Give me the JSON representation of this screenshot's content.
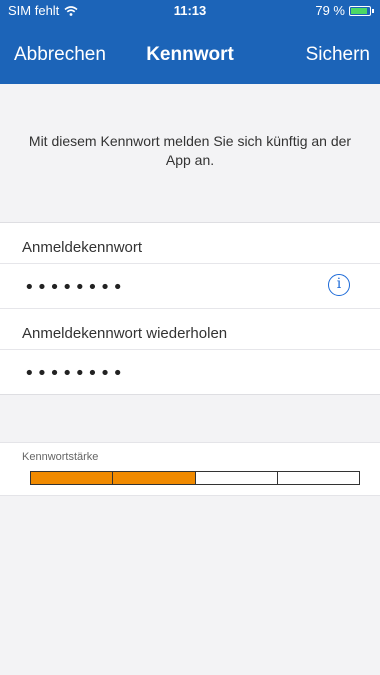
{
  "status": {
    "carrier": "SIM fehlt",
    "time": "11:13",
    "battery": "79 %"
  },
  "nav": {
    "cancel": "Abbrechen",
    "title": "Kennwort",
    "save": "Sichern"
  },
  "info_text": "Mit diesem Kennwort melden Sie sich künftig an der App an.",
  "form": {
    "password_label": "Anmeldekennwort",
    "password_value": "••••••••",
    "repeat_label": "Anmeldekennwort wiederholen",
    "repeat_value": "••••••••"
  },
  "strength": {
    "label": "Kennwortstärke",
    "segments_filled": 2,
    "segments_total": 4,
    "fill_color": "#f08a00"
  },
  "colors": {
    "header": "#1c64b8",
    "info_icon": "#1c6ad8"
  },
  "icons": {
    "wifi": "wifi-icon",
    "battery": "battery-icon",
    "info": "info-icon"
  }
}
